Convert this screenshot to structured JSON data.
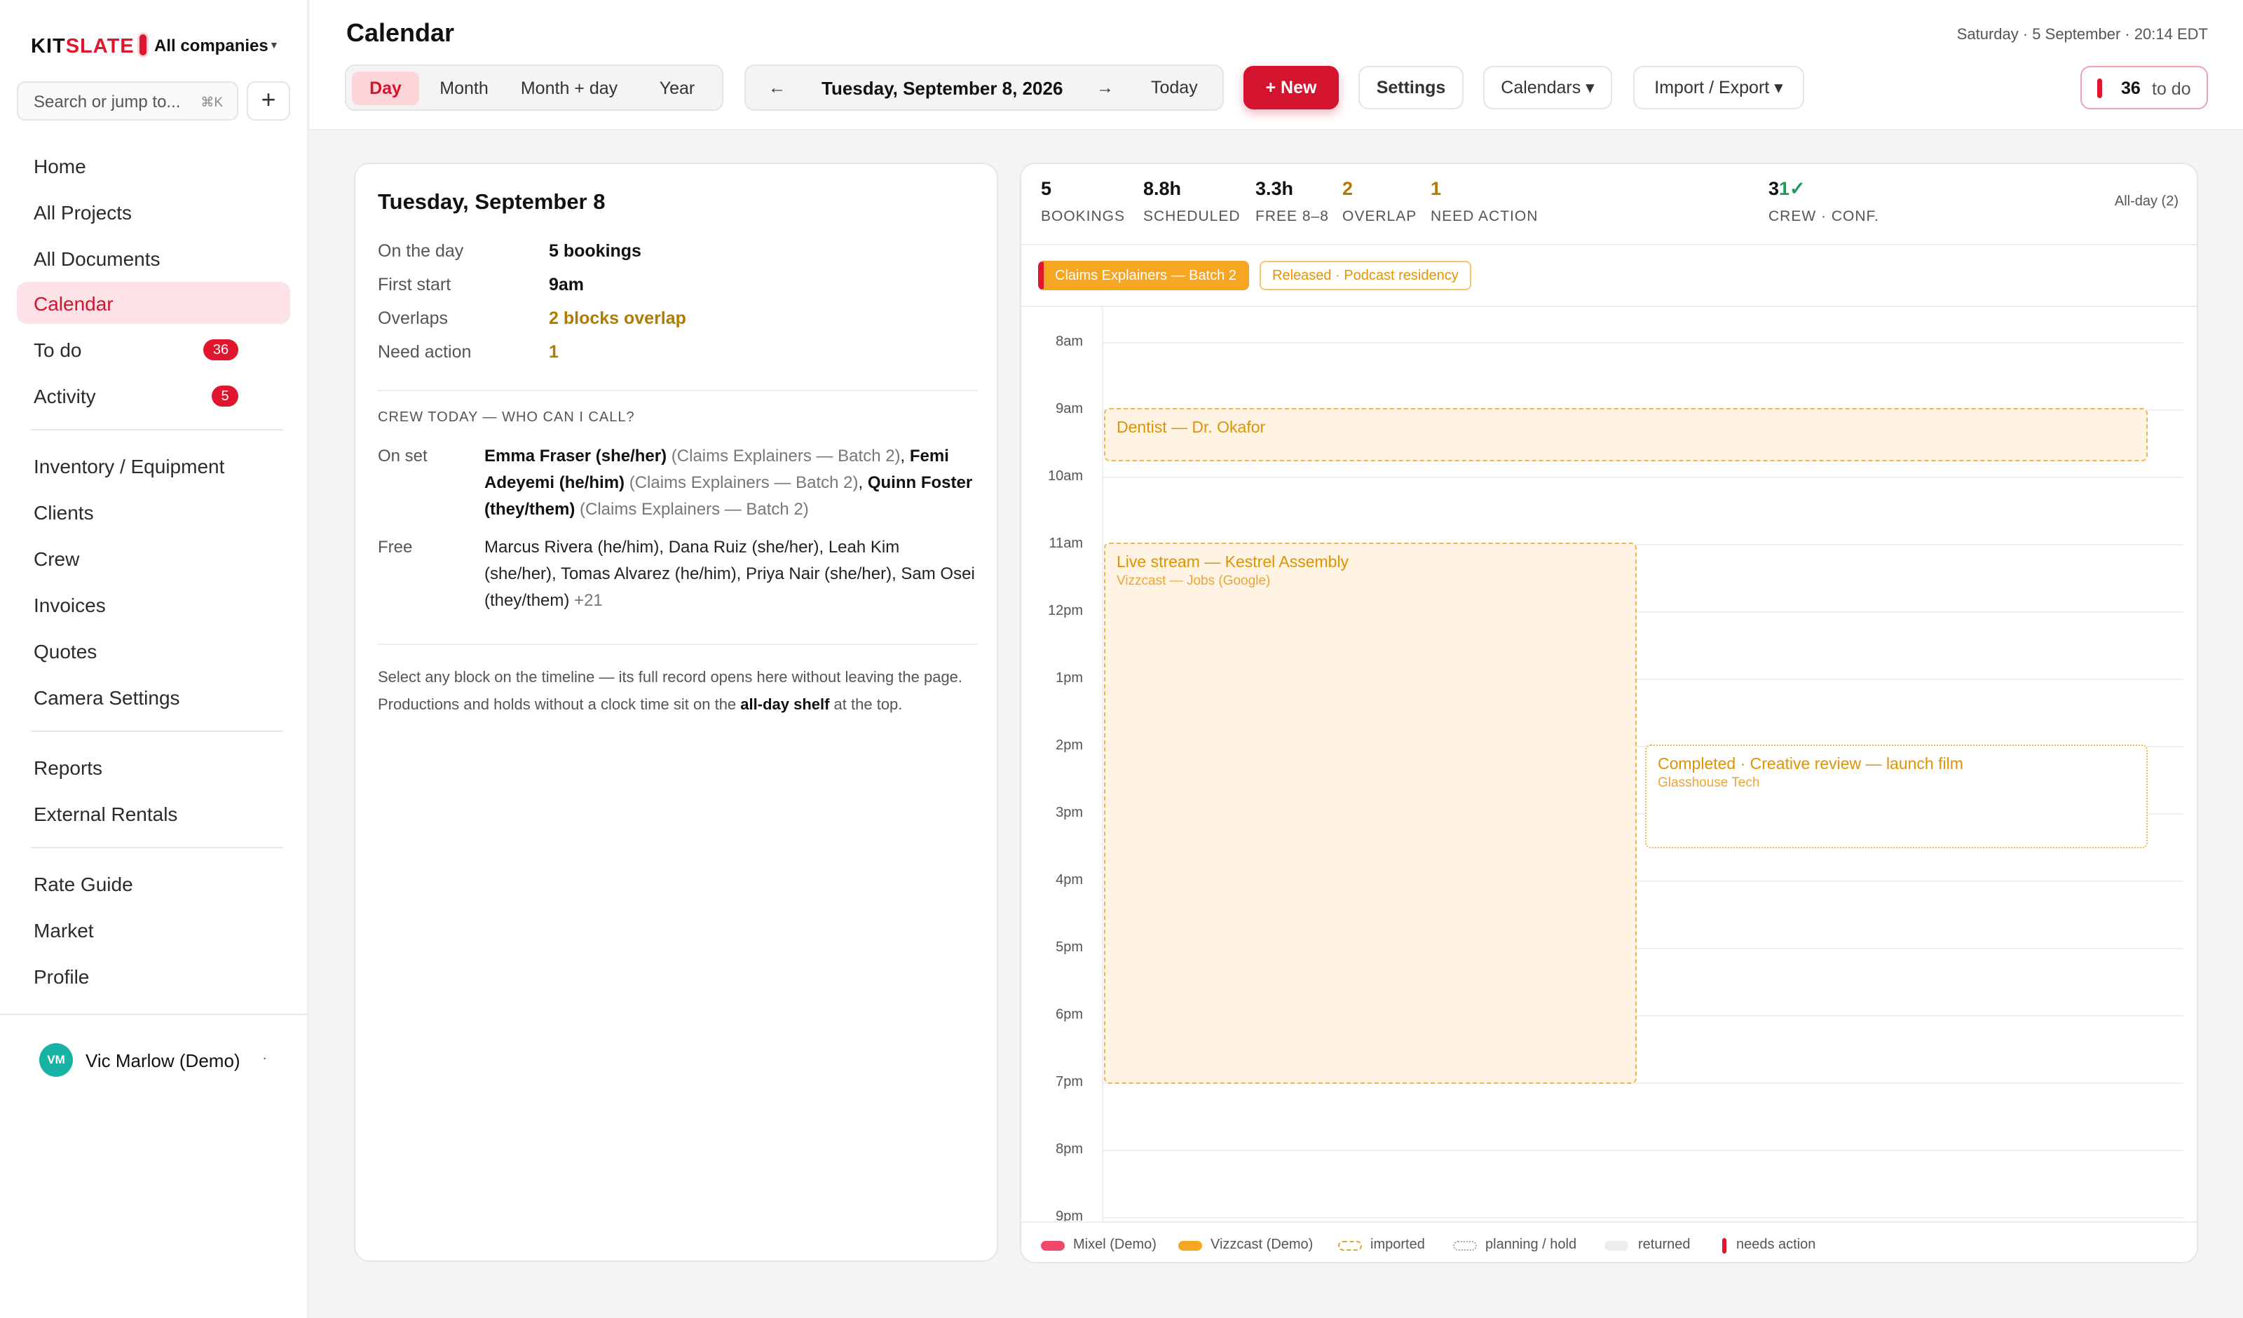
{
  "sidebar": {
    "brand": {
      "a": "KIT",
      "b": "SLATE"
    },
    "company": "All companies",
    "search_placeholder": "Search or jump to...",
    "search_kbd": "⌘K",
    "add_icon": "plus-icon",
    "items": [
      {
        "label": "Home"
      },
      {
        "label": "All Projects"
      },
      {
        "label": "All Documents"
      },
      {
        "label": "Calendar",
        "active": true
      },
      {
        "label": "To do",
        "badge": "36"
      },
      {
        "label": "Activity",
        "badge": "5"
      },
      {
        "label": "Inventory / Equipment"
      },
      {
        "label": "Clients"
      },
      {
        "label": "Crew"
      },
      {
        "label": "Invoices"
      },
      {
        "label": "Quotes"
      },
      {
        "label": "Camera Settings"
      },
      {
        "label": "Reports"
      },
      {
        "label": "External Rentals"
      },
      {
        "label": "Rate Guide"
      },
      {
        "label": "Market"
      },
      {
        "label": "Profile"
      }
    ],
    "user": {
      "initials": "VM",
      "name": "Vic Marlow (Demo)"
    }
  },
  "header": {
    "title": "Calendar",
    "datetime": "Saturday · 5 September · 20:14 EDT",
    "views": [
      "Day",
      "Month",
      "Month + day",
      "Year"
    ],
    "active_view": "Day",
    "prev_icon": "←",
    "next_icon": "→",
    "current_date": "Tuesday, September 8, 2026",
    "today": "Today",
    "new_label": "+ New",
    "settings": "Settings",
    "calendars": "Calendars ▾",
    "import_export": "Import / Export ▾",
    "todo_count": "36",
    "todo_label": "to do"
  },
  "detail": {
    "title": "Tuesday, September 8",
    "rows": [
      {
        "k": "On the day",
        "v": "5 bookings"
      },
      {
        "k": "First start",
        "v": "9am"
      },
      {
        "k": "Overlaps",
        "v": "2 blocks overlap"
      },
      {
        "k": "Need action",
        "v": "1"
      }
    ],
    "crew_heading": "CREW TODAY — WHO CAN I CALL?",
    "on_set_label": "On set",
    "free_label": "Free",
    "on_set": [
      {
        "name": "Emma Fraser (she/her)",
        "note": "(Claims Explainers — Batch 2)"
      },
      {
        "name": "Femi Adeyemi (he/him)",
        "note": "(Claims Explainers — Batch 2)"
      },
      {
        "name": "Quinn Foster (they/them)",
        "note": "(Claims Explainers — Batch 2)"
      }
    ],
    "free": "Marcus Rivera (he/him), Dana Ruiz (she/her), Leah Kim (she/her), Tomas Alvarez (he/him), Priya Nair (she/her), Sam Osei (they/them)",
    "free_more": "+21",
    "note_a": "Select any block on the timeline — its full record opens here without leaving the page. Productions and holds without a clock time sit on the ",
    "note_b": "all-day shelf",
    "note_c": " at the top."
  },
  "calendar": {
    "stats": [
      {
        "n": "5",
        "label": "BOOKINGS"
      },
      {
        "n": "8.8h",
        "label": "SCHEDULED"
      },
      {
        "n": "3.3h",
        "label": "FREE 8–8"
      },
      {
        "n": "2",
        "label": "OVERLAP",
        "warn": true
      },
      {
        "n": "1",
        "label": "NEED ACTION",
        "warn": true
      },
      {
        "n": "3",
        "check": "1✓",
        "label": "CREW · CONF."
      }
    ],
    "allday_label": "All-day (2)",
    "allday_chips": [
      "Claims Explainers — Batch 2",
      "Released · Podcast residency"
    ],
    "hours": [
      "8am",
      "9am",
      "10am",
      "11am",
      "12pm",
      "1pm",
      "2pm",
      "3pm",
      "4pm",
      "5pm",
      "6pm",
      "7pm",
      "8pm",
      "9pm"
    ],
    "events": [
      {
        "title": "Dentist — Dr. Okafor",
        "sub": "",
        "start": 9.0,
        "end": 9.75
      },
      {
        "title": "Live stream — Kestrel Assembly",
        "sub": "Vizzcast — Jobs (Google)",
        "start": 11.0,
        "end": 19.0
      },
      {
        "title": "Completed · Creative review — launch film",
        "sub": "Glasshouse Tech",
        "start": 14.0,
        "end": 15.5
      }
    ],
    "legend": [
      "Mixel (Demo)",
      "Vizzcast (Demo)",
      "imported",
      "planning / hold",
      "returned",
      "needs action"
    ],
    "colors": {
      "accent": "#d4142e",
      "mixel": "#f0476a",
      "vizzcast": "#f5a623",
      "warn": "#b07b00"
    }
  }
}
